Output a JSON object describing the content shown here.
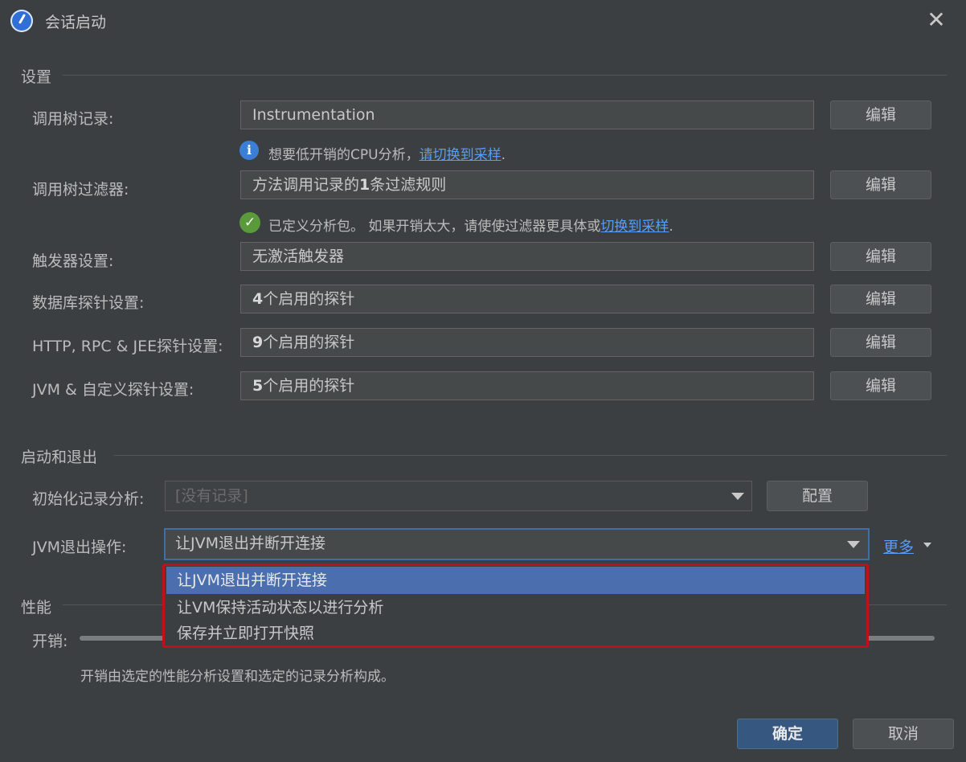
{
  "window": {
    "title": "会话启动"
  },
  "settings": {
    "section_title": "设置",
    "rows": [
      {
        "label": "调用树记录:",
        "value": "Instrumentation",
        "button": "编辑"
      },
      {
        "label": "调用树过滤器:",
        "value_bold": "",
        "value_prefix": "方法调用记录的",
        "value_num": "1",
        "value_suffix": "条过滤规则",
        "button": "编辑"
      },
      {
        "label": "触发器设置:",
        "value": "无激活触发器",
        "button": "编辑"
      },
      {
        "label": "数据库探针设置:",
        "value_num": "4",
        "value_suffix": "个启用的探针",
        "button": "编辑"
      },
      {
        "label": "HTTP, RPC & JEE探针设置:",
        "value_num": "9",
        "value_suffix": "个启用的探针",
        "button": "编辑"
      },
      {
        "label": "JVM & 自定义探针设置:",
        "value_num": "5",
        "value_suffix": "个启用的探针",
        "button": "编辑"
      }
    ],
    "hint_cpu": {
      "text": "想要低开销的CPU分析，",
      "link": "请切换到采样",
      "end": "."
    },
    "hint_filter": {
      "text": "已定义分析包。 如果开销太大，请使使过滤器更具体或",
      "link": "切换到采样",
      "end": "."
    }
  },
  "startup": {
    "section_title": "启动和退出",
    "init_label": "初始化记录分析:",
    "init_value": "[没有记录]",
    "config_button": "配置",
    "exit_label": "JVM退出操作:",
    "exit_value": "让JVM退出并断开连接",
    "more_link": "更多",
    "options": [
      "让JVM退出并断开连接",
      "让VM保持活动状态以进行分析",
      "保存并立即打开快照"
    ]
  },
  "performance": {
    "section_title": "性能",
    "overhead_label": "开销:",
    "overhead_note": "开销由选定的性能分析设置和选定的记录分析构成。"
  },
  "footer": {
    "ok": "确定",
    "cancel": "取消"
  },
  "colors": {
    "background": "#3c3f41",
    "accent": "#4b6eaf",
    "link": "#589df6",
    "highlight_border": "#c0101a"
  }
}
